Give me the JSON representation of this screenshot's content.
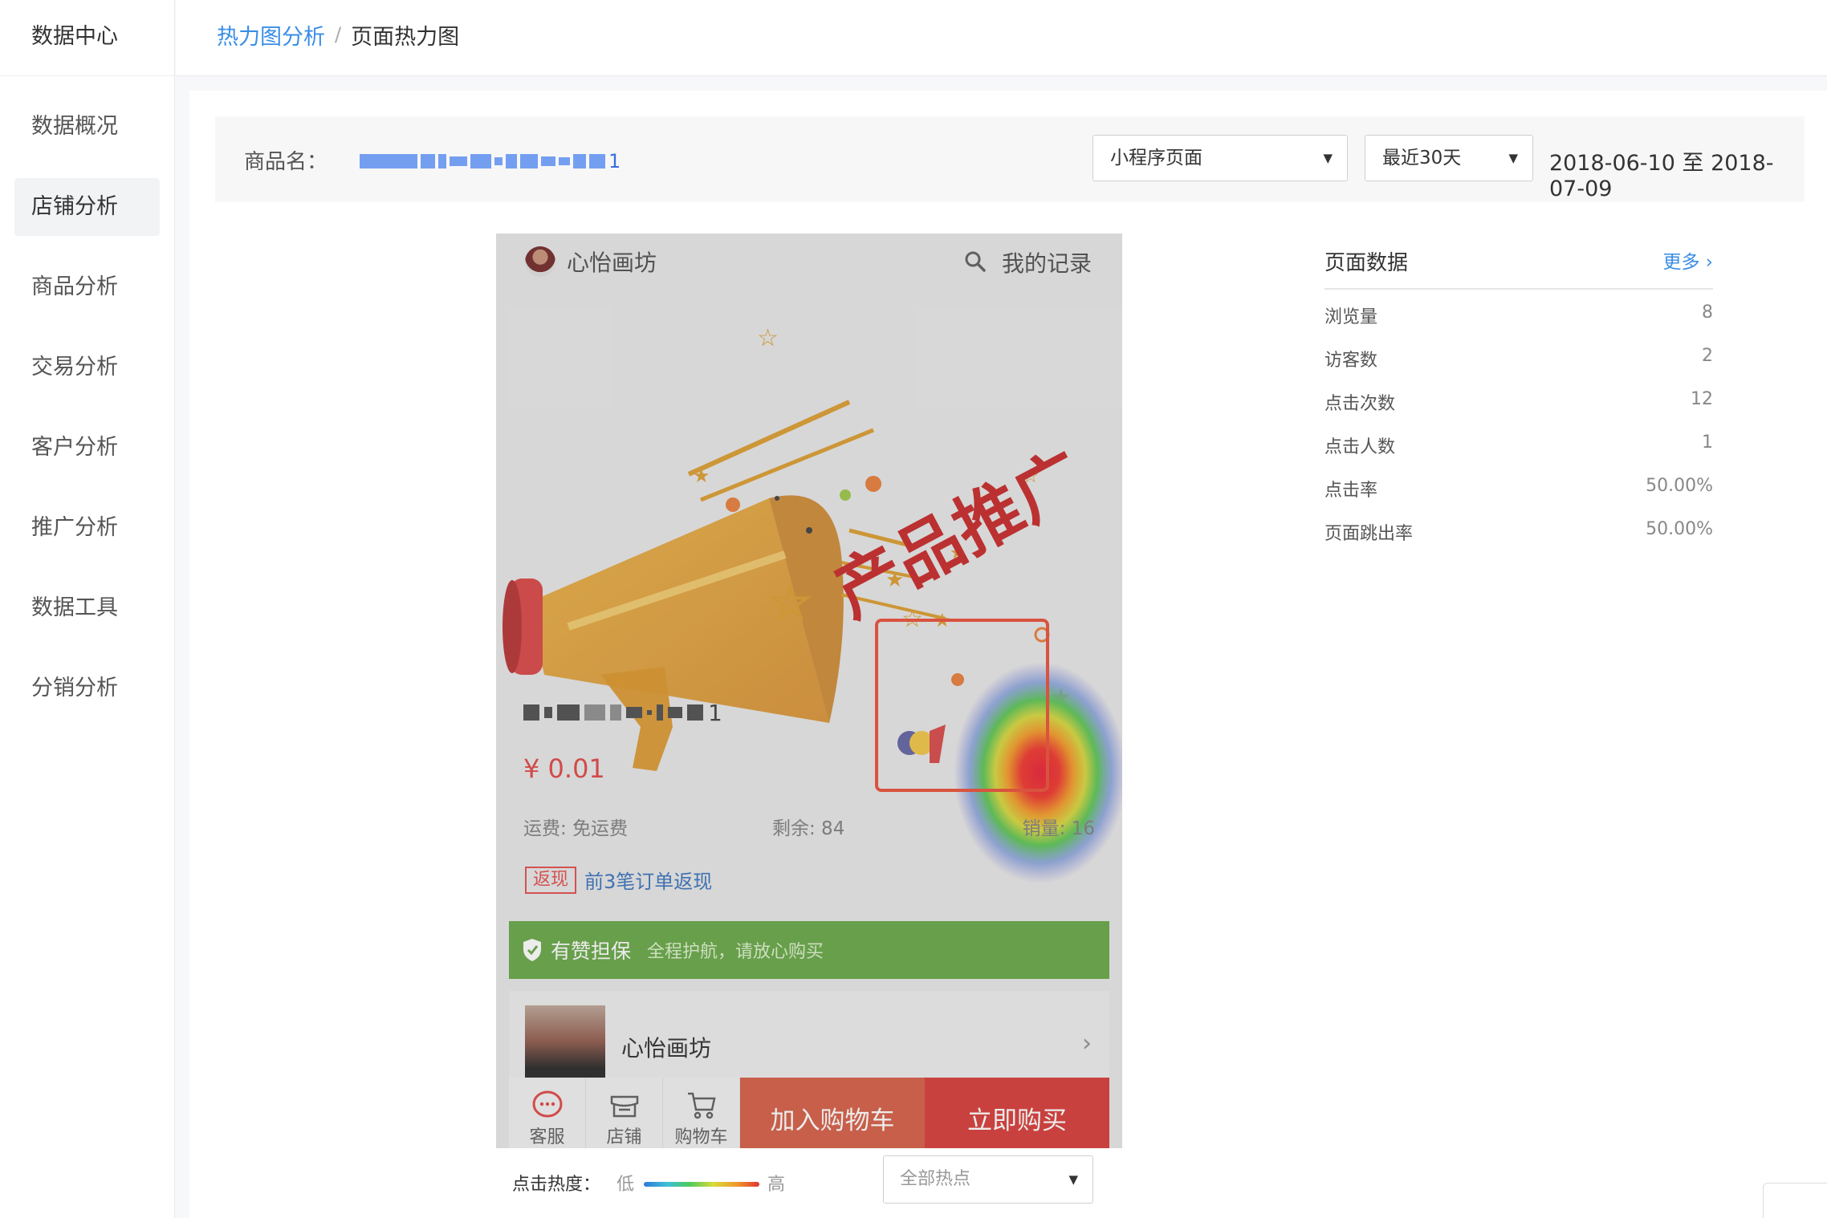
{
  "sidebar": {
    "title": "数据中心",
    "items": [
      {
        "label": "数据概况"
      },
      {
        "label": "店铺分析"
      },
      {
        "label": "商品分析"
      },
      {
        "label": "交易分析"
      },
      {
        "label": "客户分析"
      },
      {
        "label": "推广分析"
      },
      {
        "label": "数据工具"
      },
      {
        "label": "分销分析"
      }
    ]
  },
  "breadcrumb": {
    "parent": "热力图分析",
    "separator": "/",
    "current": "页面热力图"
  },
  "filters": {
    "goods_label": "商品名：",
    "goods_name_tail": "1",
    "page_type": "小程序页面",
    "time_range": "最近30天",
    "date_range": "2018-06-10 至 2018-07-09"
  },
  "preview": {
    "shop_name": "心怡画坊",
    "my_records": "我的记录",
    "banner_text": "产品推广",
    "product_title_tail": "1",
    "price": "¥ 0.01",
    "shipping": "运费: 免运费",
    "stock": "剩余: 84",
    "sales": "销量: 16",
    "cashback_tag": "返现",
    "cashback_text": "前3笔订单返现",
    "guarantee_main": "有赞担保",
    "guarantee_sub": "全程护航，请放心购买",
    "shop_card_name": "心怡画坊",
    "actions": {
      "service": "客服",
      "store": "店铺",
      "cart_icon": "购物车",
      "add_cart": "加入购物车",
      "buy_now": "立即购买"
    },
    "heat_color_high": "#e23434",
    "highlight_color": "#e8452c"
  },
  "legend": {
    "label": "点击热度：",
    "low": "低",
    "high": "高",
    "hotspot_filter": "全部热点"
  },
  "page_data": {
    "title": "页面数据",
    "more": "更多",
    "rows": [
      {
        "key": "浏览量",
        "value": "8"
      },
      {
        "key": "访客数",
        "value": "2"
      },
      {
        "key": "点击次数",
        "value": "12"
      },
      {
        "key": "点击人数",
        "value": "1"
      },
      {
        "key": "点击率",
        "value": "50.00%"
      },
      {
        "key": "页面跳出率",
        "value": "50.00%"
      }
    ]
  }
}
